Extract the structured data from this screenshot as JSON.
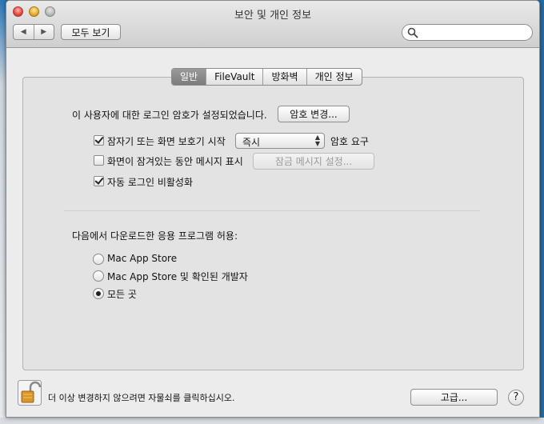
{
  "window": {
    "title": "보안 및 개인 정보"
  },
  "toolbar": {
    "show_all_label": "모두 보기",
    "back_glyph": "◀",
    "forward_glyph": "▶",
    "search_placeholder": ""
  },
  "tabs": [
    {
      "label": "일반",
      "active": true
    },
    {
      "label": "FileVault",
      "active": false
    },
    {
      "label": "방화벽",
      "active": false
    },
    {
      "label": "개인 정보",
      "active": false
    }
  ],
  "general": {
    "password_set_text": "이 사용자에 대한 로그인 암호가 설정되었습니다.",
    "change_password_label": "암호 변경...",
    "require_password": {
      "label": "잠자기 또는 화면 보호기 시작",
      "checked": true,
      "select_value": "즉시",
      "suffix": "암호 요구"
    },
    "show_message": {
      "label": "화면이 잠겨있는 동안 메시지 표시",
      "checked": false,
      "button_label": "잠금 메시지 설정..."
    },
    "disable_auto_login": {
      "label": "자동 로그인 비활성화",
      "checked": true
    },
    "allow_apps_heading": "다음에서 다운로드한 응용 프로그램 허용:",
    "allow_options": [
      {
        "label": "Mac App Store",
        "selected": false
      },
      {
        "label": "Mac App Store 및 확인된 개발자",
        "selected": false
      },
      {
        "label": "모든 곳",
        "selected": true
      }
    ]
  },
  "footer": {
    "lock_text": "더 이상 변경하지 않으려면 자물쇠를 클릭하십시오.",
    "advanced_label": "고급...",
    "help_label": "?"
  },
  "colors": {
    "active_tab": "#8a8a8a",
    "desktop": "#1f6fae"
  }
}
